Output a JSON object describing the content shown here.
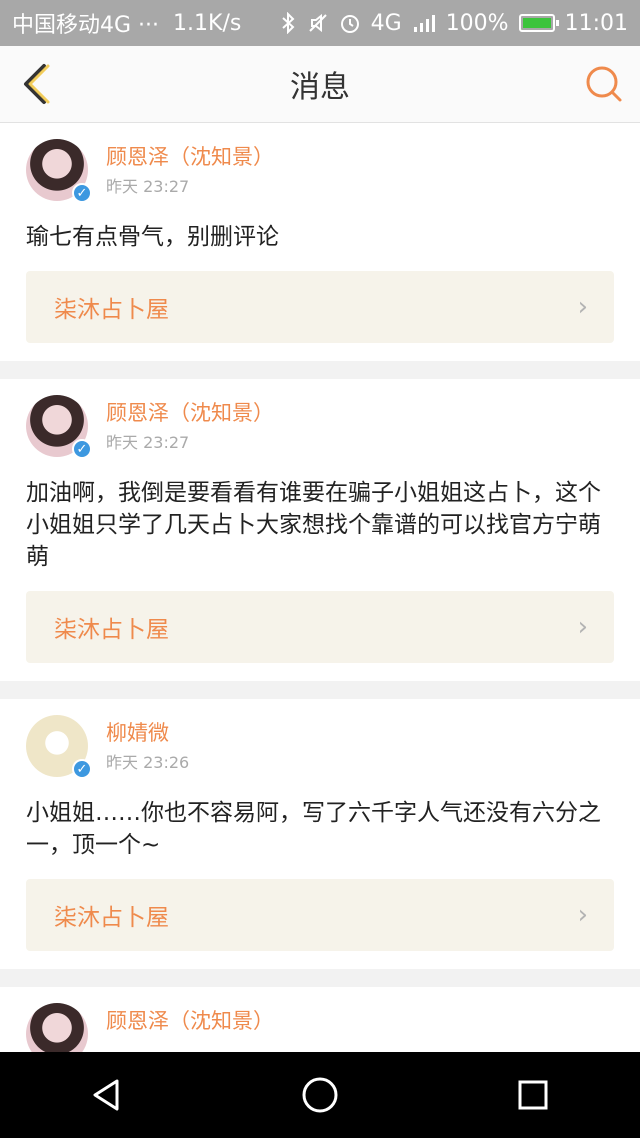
{
  "status_bar": {
    "carrier": "中国移动4G ···",
    "speed": "1.1K/s",
    "network": "4G",
    "battery": "100%",
    "time": "11:01"
  },
  "header": {
    "title": "消息"
  },
  "messages": [
    {
      "username": "顾恩泽（沈知景）",
      "time": "昨天 23:27",
      "text": "瑜七有点骨气，别删评论",
      "link": "柒沐占卜屋"
    },
    {
      "username": "顾恩泽（沈知景）",
      "time": "昨天 23:27",
      "text": "加油啊，我倒是要看看有谁要在骗子小姐姐这占卜，这个小姐姐只学了几天占卜大家想找个靠谱的可以找官方宁萌萌",
      "link": "柒沐占卜屋"
    },
    {
      "username": "柳婧微",
      "time": "昨天 23:26",
      "text": "小姐姐……你也不容易阿，写了六千字人气还没有六分之一，顶一个~",
      "link": "柒沐占卜屋"
    },
    {
      "username": "顾恩泽（沈知景）"
    }
  ],
  "colors": {
    "accent": "#ef8a4c",
    "link_bg": "#f6f3ea",
    "verified": "#3d98e0"
  }
}
